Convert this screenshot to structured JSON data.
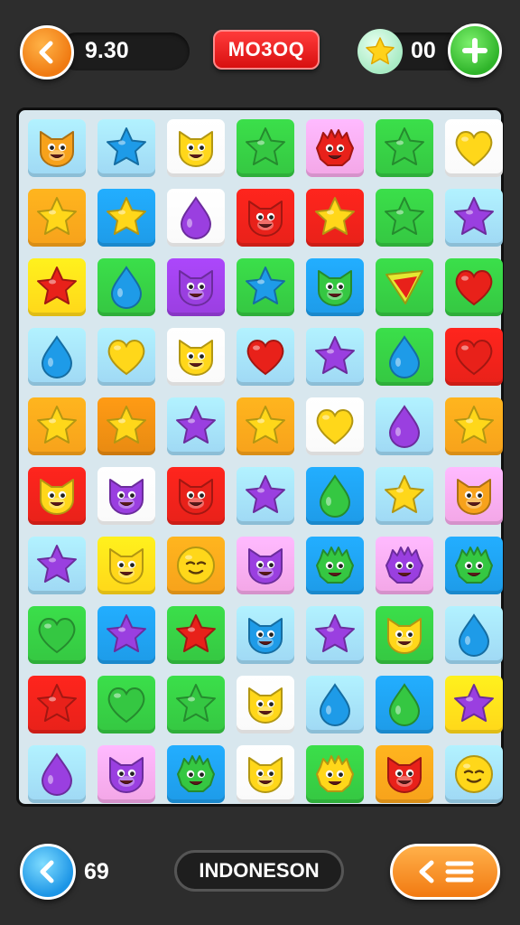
{
  "header": {
    "timer": "9.30",
    "logo_text": "MO3OQ",
    "stars": "00"
  },
  "footer": {
    "moves": "69",
    "level_name": "INDONESON"
  },
  "colors": {
    "orange": "#f7a21b",
    "blue": "#1e9be8",
    "green": "#35c742",
    "red": "#e8211a",
    "pink": "#f3a6e6",
    "white": "#fafafa",
    "yellow": "#ffd71a",
    "purple": "#9a3fe0",
    "lightblue": "#9fd8f4",
    "amber": "#e88a12"
  },
  "board": {
    "columns": 7,
    "rows": [
      [
        {
          "bg": "lightblue",
          "piece": "cat",
          "color": "orange"
        },
        {
          "bg": "lightblue",
          "piece": "star",
          "color": "blue"
        },
        {
          "bg": "white",
          "piece": "cat",
          "color": "yellow"
        },
        {
          "bg": "green",
          "piece": "star",
          "color": "green"
        },
        {
          "bg": "pink",
          "piece": "fuzzy",
          "color": "red"
        },
        {
          "bg": "green",
          "piece": "star",
          "color": "green"
        },
        {
          "bg": "white",
          "piece": "heart",
          "color": "yellow"
        }
      ],
      [
        {
          "bg": "orange",
          "piece": "star",
          "color": "yellow"
        },
        {
          "bg": "blue",
          "piece": "star",
          "color": "yellow"
        },
        {
          "bg": "white",
          "piece": "drop",
          "color": "purple"
        },
        {
          "bg": "red",
          "piece": "cat",
          "color": "red"
        },
        {
          "bg": "red",
          "piece": "star",
          "color": "yellow"
        },
        {
          "bg": "green",
          "piece": "star",
          "color": "green"
        },
        {
          "bg": "lightblue",
          "piece": "star",
          "color": "purple"
        }
      ],
      [
        {
          "bg": "yellow",
          "piece": "star",
          "color": "red"
        },
        {
          "bg": "green",
          "piece": "drop",
          "color": "blue"
        },
        {
          "bg": "purple",
          "piece": "cat",
          "color": "purple"
        },
        {
          "bg": "green",
          "piece": "star",
          "color": "blue"
        },
        {
          "bg": "blue",
          "piece": "cat",
          "color": "green"
        },
        {
          "bg": "green",
          "piece": "triangle",
          "color": "red"
        },
        {
          "bg": "green",
          "piece": "heart",
          "color": "red"
        }
      ],
      [
        {
          "bg": "lightblue",
          "piece": "drop",
          "color": "blue"
        },
        {
          "bg": "lightblue",
          "piece": "heart",
          "color": "yellow"
        },
        {
          "bg": "white",
          "piece": "cat",
          "color": "yellow"
        },
        {
          "bg": "lightblue",
          "piece": "heart",
          "color": "red"
        },
        {
          "bg": "lightblue",
          "piece": "star",
          "color": "purple"
        },
        {
          "bg": "green",
          "piece": "drop",
          "color": "blue"
        },
        {
          "bg": "red",
          "piece": "heart",
          "color": "red"
        }
      ],
      [
        {
          "bg": "orange",
          "piece": "star",
          "color": "yellow"
        },
        {
          "bg": "amber",
          "piece": "star",
          "color": "yellow"
        },
        {
          "bg": "lightblue",
          "piece": "star",
          "color": "purple"
        },
        {
          "bg": "orange",
          "piece": "star",
          "color": "yellow"
        },
        {
          "bg": "white",
          "piece": "heart",
          "color": "yellow"
        },
        {
          "bg": "lightblue",
          "piece": "drop",
          "color": "purple"
        },
        {
          "bg": "orange",
          "piece": "star",
          "color": "yellow"
        }
      ],
      [
        {
          "bg": "red",
          "piece": "cat",
          "color": "yellow"
        },
        {
          "bg": "white",
          "piece": "cat",
          "color": "purple"
        },
        {
          "bg": "red",
          "piece": "cat",
          "color": "red"
        },
        {
          "bg": "lightblue",
          "piece": "star",
          "color": "purple"
        },
        {
          "bg": "blue",
          "piece": "drop",
          "color": "green"
        },
        {
          "bg": "lightblue",
          "piece": "star",
          "color": "yellow"
        },
        {
          "bg": "pink",
          "piece": "cat",
          "color": "orange"
        }
      ],
      [
        {
          "bg": "lightblue",
          "piece": "star",
          "color": "purple"
        },
        {
          "bg": "yellow",
          "piece": "cat",
          "color": "yellow"
        },
        {
          "bg": "orange",
          "piece": "face",
          "color": "yellow"
        },
        {
          "bg": "pink",
          "piece": "cat",
          "color": "purple"
        },
        {
          "bg": "blue",
          "piece": "fuzzy",
          "color": "green"
        },
        {
          "bg": "pink",
          "piece": "fuzzy",
          "color": "purple"
        },
        {
          "bg": "blue",
          "piece": "fuzzy",
          "color": "green"
        }
      ],
      [
        {
          "bg": "green",
          "piece": "heart",
          "color": "green"
        },
        {
          "bg": "blue",
          "piece": "star",
          "color": "purple"
        },
        {
          "bg": "green",
          "piece": "star",
          "color": "red"
        },
        {
          "bg": "lightblue",
          "piece": "cat",
          "color": "blue"
        },
        {
          "bg": "lightblue",
          "piece": "star",
          "color": "purple"
        },
        {
          "bg": "green",
          "piece": "cat",
          "color": "yellow"
        },
        {
          "bg": "lightblue",
          "piece": "drop",
          "color": "blue"
        }
      ],
      [
        {
          "bg": "red",
          "piece": "star",
          "color": "red"
        },
        {
          "bg": "green",
          "piece": "heart",
          "color": "green"
        },
        {
          "bg": "green",
          "piece": "star",
          "color": "green"
        },
        {
          "bg": "white",
          "piece": "cat",
          "color": "yellow"
        },
        {
          "bg": "lightblue",
          "piece": "drop",
          "color": "blue"
        },
        {
          "bg": "blue",
          "piece": "drop",
          "color": "green"
        },
        {
          "bg": "yellow",
          "piece": "star",
          "color": "purple"
        }
      ],
      [
        {
          "bg": "lightblue",
          "piece": "drop",
          "color": "purple"
        },
        {
          "bg": "pink",
          "piece": "cat",
          "color": "purple"
        },
        {
          "bg": "blue",
          "piece": "fuzzy",
          "color": "green"
        },
        {
          "bg": "white",
          "piece": "cat",
          "color": "yellow"
        },
        {
          "bg": "green",
          "piece": "fuzzy",
          "color": "yellow"
        },
        {
          "bg": "orange",
          "piece": "cat",
          "color": "red"
        },
        {
          "bg": "lightblue",
          "piece": "face",
          "color": "yellow"
        }
      ]
    ]
  }
}
